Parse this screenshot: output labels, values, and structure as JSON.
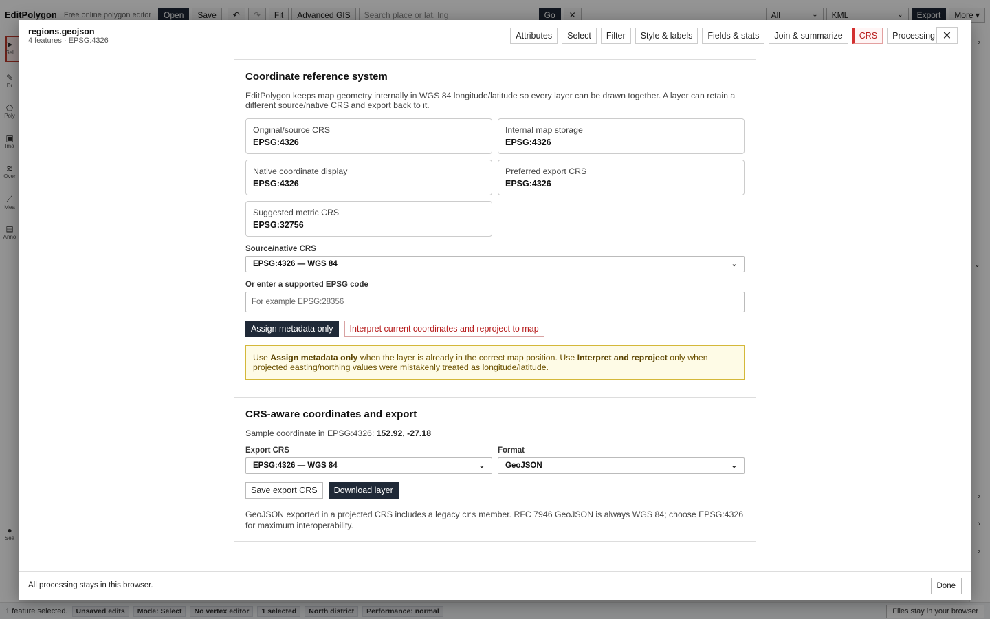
{
  "app": {
    "brand": "EditPolygon",
    "tagline": "Free online polygon editor",
    "toolbar": {
      "open": "Open",
      "save": "Save",
      "undo_icon": "↶",
      "redo_icon": "↷",
      "fit": "Fit",
      "advanced_gis": "Advanced GIS",
      "search_placeholder": "Search place or lat, lng",
      "go": "Go",
      "clear_icon": "✕",
      "filter_value": "All",
      "format_value": "KML",
      "export": "Export",
      "more": "More ▾"
    },
    "left_tools": [
      {
        "label": "Sel",
        "icon": "pointer-icon"
      },
      {
        "label": "Dr",
        "icon": "pencil-icon"
      },
      {
        "label": "Poly",
        "icon": "polygon-icon"
      },
      {
        "label": "Ima",
        "icon": "image-icon"
      },
      {
        "label": "Over",
        "icon": "layers-icon"
      },
      {
        "label": "Mea",
        "icon": "ruler-icon"
      },
      {
        "label": "Anno",
        "icon": "note-icon"
      },
      {
        "label": "Sea",
        "icon": "search-icon"
      }
    ],
    "status": {
      "selected_text": "1 feature selected.",
      "chips": [
        "Unsaved edits",
        "Mode: Select",
        "No vertex editor",
        "1 selected",
        "North district",
        "Performance: normal"
      ],
      "right_text": "Files stay in your browser"
    }
  },
  "modal": {
    "title": "regions.geojson",
    "subtitle": "4 features · EPSG:4326",
    "tabs": [
      {
        "label": "Attributes",
        "active": false
      },
      {
        "label": "Select",
        "active": false
      },
      {
        "label": "Filter",
        "active": false
      },
      {
        "label": "Style & labels",
        "active": false
      },
      {
        "label": "Fields & stats",
        "active": false
      },
      {
        "label": "Join & summarize",
        "active": false
      },
      {
        "label": "CRS",
        "active": true
      },
      {
        "label": "Processing",
        "active": false
      }
    ],
    "close_icon": "✕",
    "crs": {
      "heading": "Coordinate reference system",
      "description": "EditPolygon keeps map geometry internally in WGS 84 longitude/latitude so every layer can be drawn together. A layer can retain a different source/native CRS and export back to it.",
      "boxes": [
        {
          "label": "Original/source CRS",
          "value": "EPSG:4326"
        },
        {
          "label": "Internal map storage",
          "value": "EPSG:4326"
        },
        {
          "label": "Native coordinate display",
          "value": "EPSG:4326"
        },
        {
          "label": "Preferred export CRS",
          "value": "EPSG:4326"
        },
        {
          "label": "Suggested metric CRS",
          "value": "EPSG:32756"
        }
      ],
      "source_label": "Source/native CRS",
      "source_value": "EPSG:4326 — WGS 84",
      "epsg_label": "Or enter a supported EPSG code",
      "epsg_placeholder": "For example EPSG:28356",
      "assign_btn": "Assign metadata only",
      "reproject_btn": "Interpret current coordinates and reproject to map",
      "notice": {
        "p1": "Use ",
        "b1": "Assign metadata only",
        "p2": " when the layer is already in the correct map position. Use ",
        "b2": "Interpret and reproject",
        "p3": " only when projected easting/northing values were mistakenly treated as longitude/latitude."
      }
    },
    "export": {
      "heading": "CRS-aware coordinates and export",
      "sample_prefix": "Sample coordinate in EPSG:4326: ",
      "sample_value": "152.92, -27.18",
      "export_crs_label": "Export CRS",
      "export_crs_value": "EPSG:4326 — WGS 84",
      "format_label": "Format",
      "format_value": "GeoJSON",
      "save_btn": "Save export CRS",
      "download_btn": "Download layer",
      "note_p1": "GeoJSON exported in a projected CRS includes a legacy ",
      "note_code": "crs",
      "note_p2": " member. RFC 7946 GeoJSON is always WGS 84; choose EPSG:4326 for maximum interoperability."
    },
    "footer": {
      "text": "All processing stays in this browser.",
      "done": "Done"
    }
  }
}
